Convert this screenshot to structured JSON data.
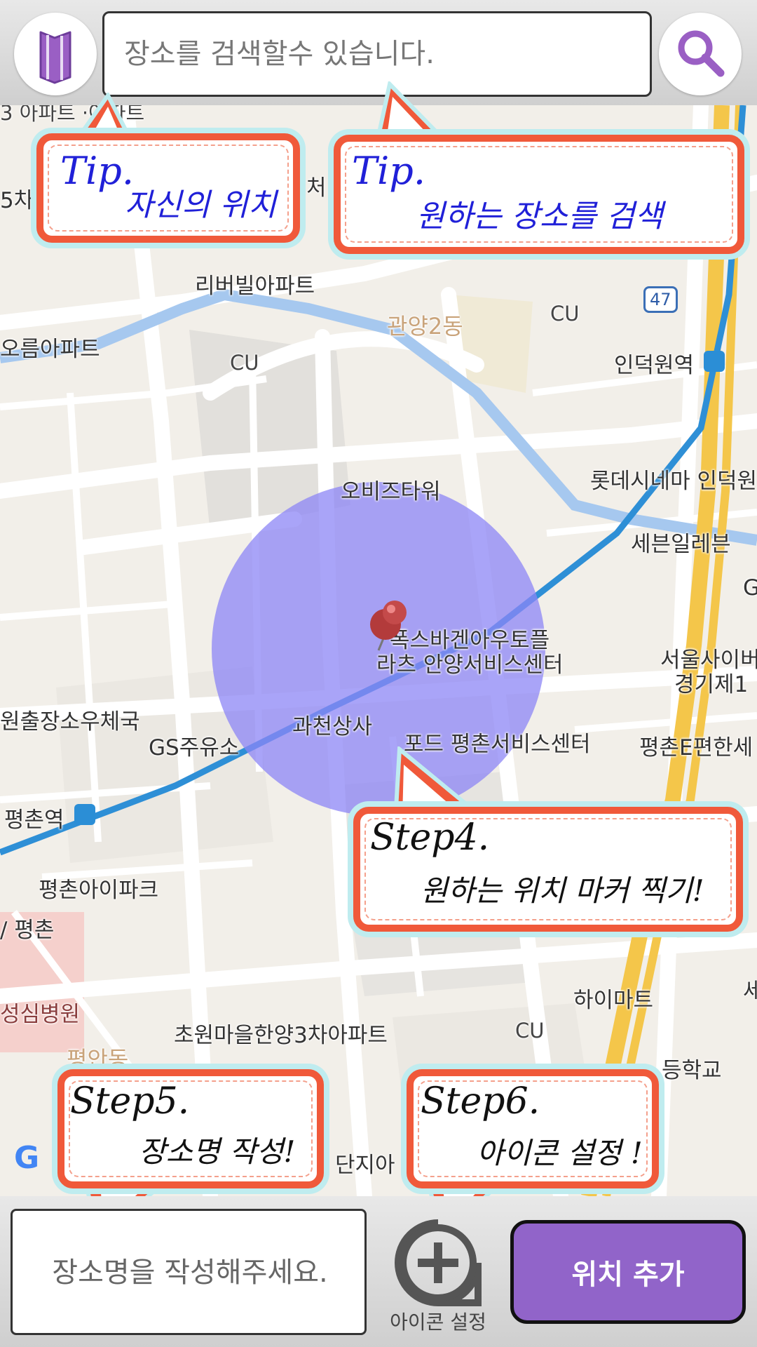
{
  "search": {
    "placeholder": "장소를 검색할수 있습니다."
  },
  "map": {
    "labels": {
      "riverville": "리버빌아파트",
      "oreum": "오름아파트",
      "cu1": "CU",
      "cu2": "CU",
      "cu3": "CU",
      "gwanyang2": "관양2동",
      "route47": "47",
      "indeogwon_station": "인덕원역",
      "lotte_cinema": "롯데시네마 인덕원",
      "seven_eleven": "세븐일레븐",
      "obiz_tower": "오비즈타워",
      "volkswagen": "폭스바겐아우토플",
      "volkswagen2": "라츠 안양서비스센터",
      "gwacheon_sangsa": "과천상사",
      "ford": "포드 평촌서비스센터",
      "gs_station": "GS주유소",
      "post_office": "원출장소우체국",
      "seoul_cyber": "서울사이버",
      "gyeonggi": "경기제1",
      "pyeongchon_e": "평촌E편한세",
      "pyeongchon_station": "평촌역",
      "pyeongchon_ipark": "평촌아이파크",
      "pyeongchon": "/ 평촌",
      "hospital": "성심병원",
      "chowon": "초원마을한양3차아파트",
      "himart": "하이마트",
      "school": "등학교",
      "danji": "단지아",
      "pyeongan": "평안동",
      "g": "G",
      "se": "세",
      "cheo": "처",
      "five_car": "5차",
      "top_cut": "3 아파트  ·아파트"
    }
  },
  "tips": {
    "my_location": {
      "head": "Tip.",
      "body": "자신의 위치"
    },
    "search_place": {
      "head": "Tip.",
      "body": "원하는 장소를 검색"
    }
  },
  "steps": {
    "step4": {
      "head": "Step4.",
      "body": "원하는 위치 마커 찍기!"
    },
    "step5": {
      "head": "Step5.",
      "body": "장소명 작성!"
    },
    "step6": {
      "head": "Step6.",
      "body": "아이콘 설정 !"
    }
  },
  "bottom": {
    "name_placeholder": "장소명을 작성해주세요.",
    "icon_setting_label": "아이콘 설정",
    "add_button_label": "위치 추가"
  },
  "colors": {
    "accent": "#9164c9",
    "bubble_border": "#f0593a",
    "bubble_glow": "#bfecef",
    "tip_text": "#2020d8",
    "radius_circle": "#8c86f5"
  },
  "icons": {
    "map_button": "map-icon",
    "search_button": "search-icon",
    "marker": "pushpin-icon",
    "icon_setting": "plus-icon"
  }
}
